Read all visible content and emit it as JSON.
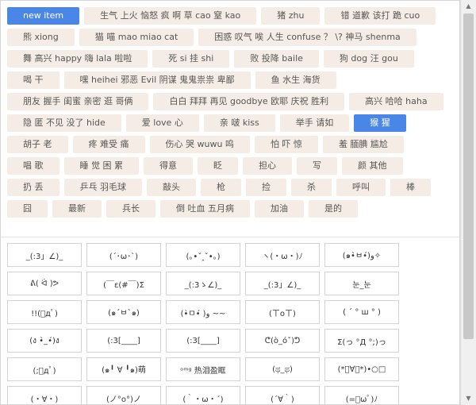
{
  "tags": [
    "new item",
    "生气 上火 恼怒 疯 啊 草 cao 窒 kao",
    "猪 zhu",
    "错 道歉 该打 跪 cuo",
    "熊 xiong",
    "猫 喵 mao miao cat",
    "困惑 叹气 唉 人生 confuse ？ \\? 神马 shenma",
    "舞 高兴 happy 嗨 lala 啦啦",
    "死 si 挂 shi",
    "败 投降 baile",
    "狗 dog 汪 gou",
    "喝 干",
    "嘿 heihei 邪恶 Evil 阴谋 鬼鬼祟祟 卑鄙",
    "鱼 水生 海货",
    "朋友 握手 闺蜜 亲密 逛 哥俩",
    "白白 拜拜 再见 goodbye 欧耶 庆祝 胜利",
    "高兴 哈哈 haha",
    "隐 匿 不见 没了 hide",
    "爱 love 心",
    "亲 啵 kiss",
    "举手 请如",
    "猴 猩",
    "胡子 老",
    "疼 难受 痛",
    "伤心 哭 wuwu 呜",
    "怕 吓 惊",
    "羞 腼腆 尴尬",
    "唱 歌",
    "睡 觉 困 累",
    "得意",
    "眨",
    "担心",
    "写",
    "颜 其他",
    "扔 丢",
    "乒乓 羽毛球",
    "敲头",
    "枪",
    "捡",
    "杀",
    "呼叫",
    "棒",
    "囧",
    "最新",
    "兵长",
    "倒 吐血 五月病",
    "加油",
    "是的"
  ],
  "active_tags": [
    "new item",
    "猴 猩"
  ],
  "emoticons": [
    "_(:3」∠)_",
    "(´･ω･`)",
    "(｡•ˇ‸ˇ•｡)",
    "ヽ(・ω・)ﾉ",
    "(๑•̀ㅂ•́)و✧",
    "ᕕ( ᐛ )ᕗ",
    "(￣ε(#￣)Σ",
    "_(:3ゝ∠)_",
    "_(:3」∠)_",
    "눈_눈",
    "!!(ﾟдﾟ)",
    "(๑´ㅂ`๑)",
    "(•̀ㅁ•́ )و ~~",
    "(ㄒoㄒ)",
    "( ´ ° ш ° )",
    "(ง •̀_•́)ง",
    "(:3[____]",
    "(:3[____]",
    "ᕦ(ò_óˇ)ᕤ",
    "Σ(っ °Д °;)っ",
    "(;ﾟдﾟ)",
    "(๑╹ ∀ ╹๑)萌",
    "ᵒᵐᵍ 热泪盈眶",
    "(ಥ_ಥ)",
    "(*ﾟ∀ﾟ*)•○□",
    "(・∀・)",
    "(ノ°ο°)ノ",
    "(｀・ω・´)",
    "(´∀｀)",
    "(=ﾟωﾟ)ﾉ"
  ],
  "scrollbar": {
    "up_icon": "▲",
    "down_icon": "▼"
  }
}
